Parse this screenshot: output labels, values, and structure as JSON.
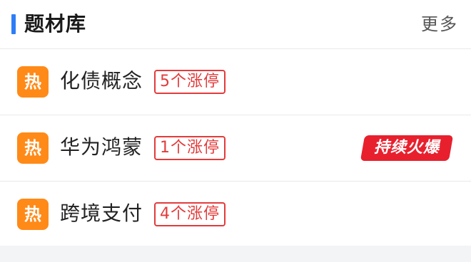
{
  "colors": {
    "accent_bar": "#2e7df6",
    "hot_icon_bg": "#ff8a18",
    "badge_red": "#e33b3b",
    "tag_red": "#e8202e",
    "footer_gray": "#f3f4f6"
  },
  "header": {
    "title": "题材库",
    "more_label": "更多"
  },
  "topics": [
    {
      "icon_text": "热",
      "icon": "hot-icon",
      "name": "化债概念",
      "limit_text": "5个涨停",
      "tag": ""
    },
    {
      "icon_text": "热",
      "icon": "hot-icon",
      "name": "华为鸿蒙",
      "limit_text": "1个涨停",
      "tag": "持续火爆"
    },
    {
      "icon_text": "热",
      "icon": "hot-icon",
      "name": "跨境支付",
      "limit_text": "4个涨停",
      "tag": ""
    }
  ]
}
